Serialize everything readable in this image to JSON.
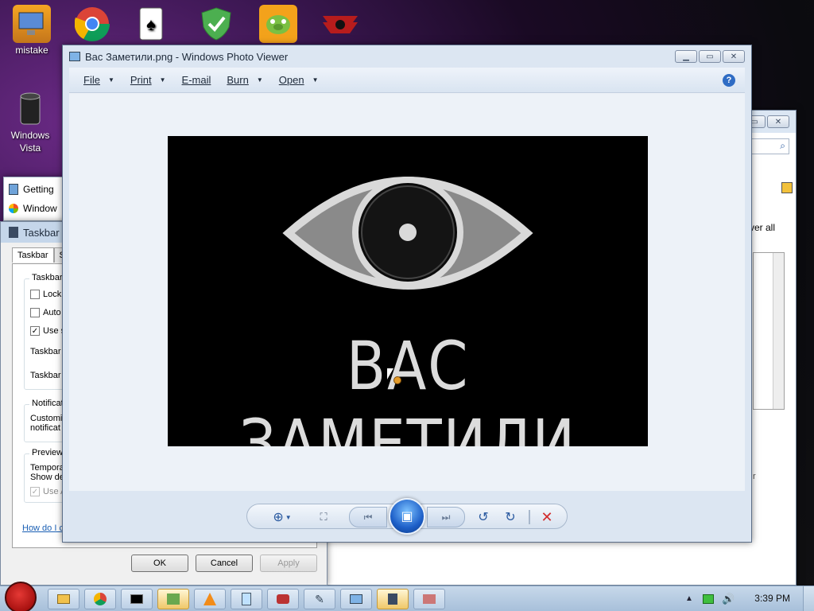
{
  "desktop": {
    "icons": [
      {
        "label": "mistake",
        "icon": "computer-monitor-icon"
      },
      {
        "label": "",
        "icon": "chrome-icon"
      },
      {
        "label": "",
        "icon": "solitaire-icon"
      },
      {
        "label": "",
        "icon": "security-shield-icon"
      },
      {
        "label": "",
        "icon": "angry-birds-pig-icon"
      },
      {
        "label": "",
        "icon": "red-emblem-icon"
      },
      {
        "label": "Windows\nVista",
        "icon": "recycle-bin-icon"
      }
    ]
  },
  "start_strip": {
    "items": [
      "Getting",
      "Window"
    ]
  },
  "taskbar_dialog": {
    "title": "Taskbar",
    "tabs": [
      "Taskbar",
      "S"
    ],
    "group_taskbar": "Taskbar",
    "checks": [
      {
        "label": "Lock",
        "checked": false
      },
      {
        "label": "Auto",
        "checked": false
      },
      {
        "label": "Use s",
        "checked": true
      }
    ],
    "row1": "Taskbar",
    "row2": "Taskbar",
    "group_notif": "Notificat",
    "notif_text1": "Customiz",
    "notif_text2": "notificat",
    "group_preview": "Preview",
    "preview_text1": "Tempora",
    "preview_text2": "Show de",
    "preview_check": "Use A",
    "link": "How do I c",
    "ok": "OK",
    "cancel": "Cancel",
    "apply": "Apply"
  },
  "back_window": {
    "text": "ver all",
    "text2": "r"
  },
  "photo_viewer": {
    "title": "Вас Заметили.png - Windows Photo Viewer",
    "menu": {
      "file": "File",
      "print": "Print",
      "email": "E-mail",
      "burn": "Burn",
      "open": "Open"
    },
    "image_caption": "ВАС ЗАМЕТИЛИ",
    "help": "?"
  },
  "taskbar": {
    "clock": "3:39 PM"
  },
  "colors": {
    "accent": "#2a5aa0",
    "delete": "#d22b2b",
    "active_task": "#f0c869"
  }
}
